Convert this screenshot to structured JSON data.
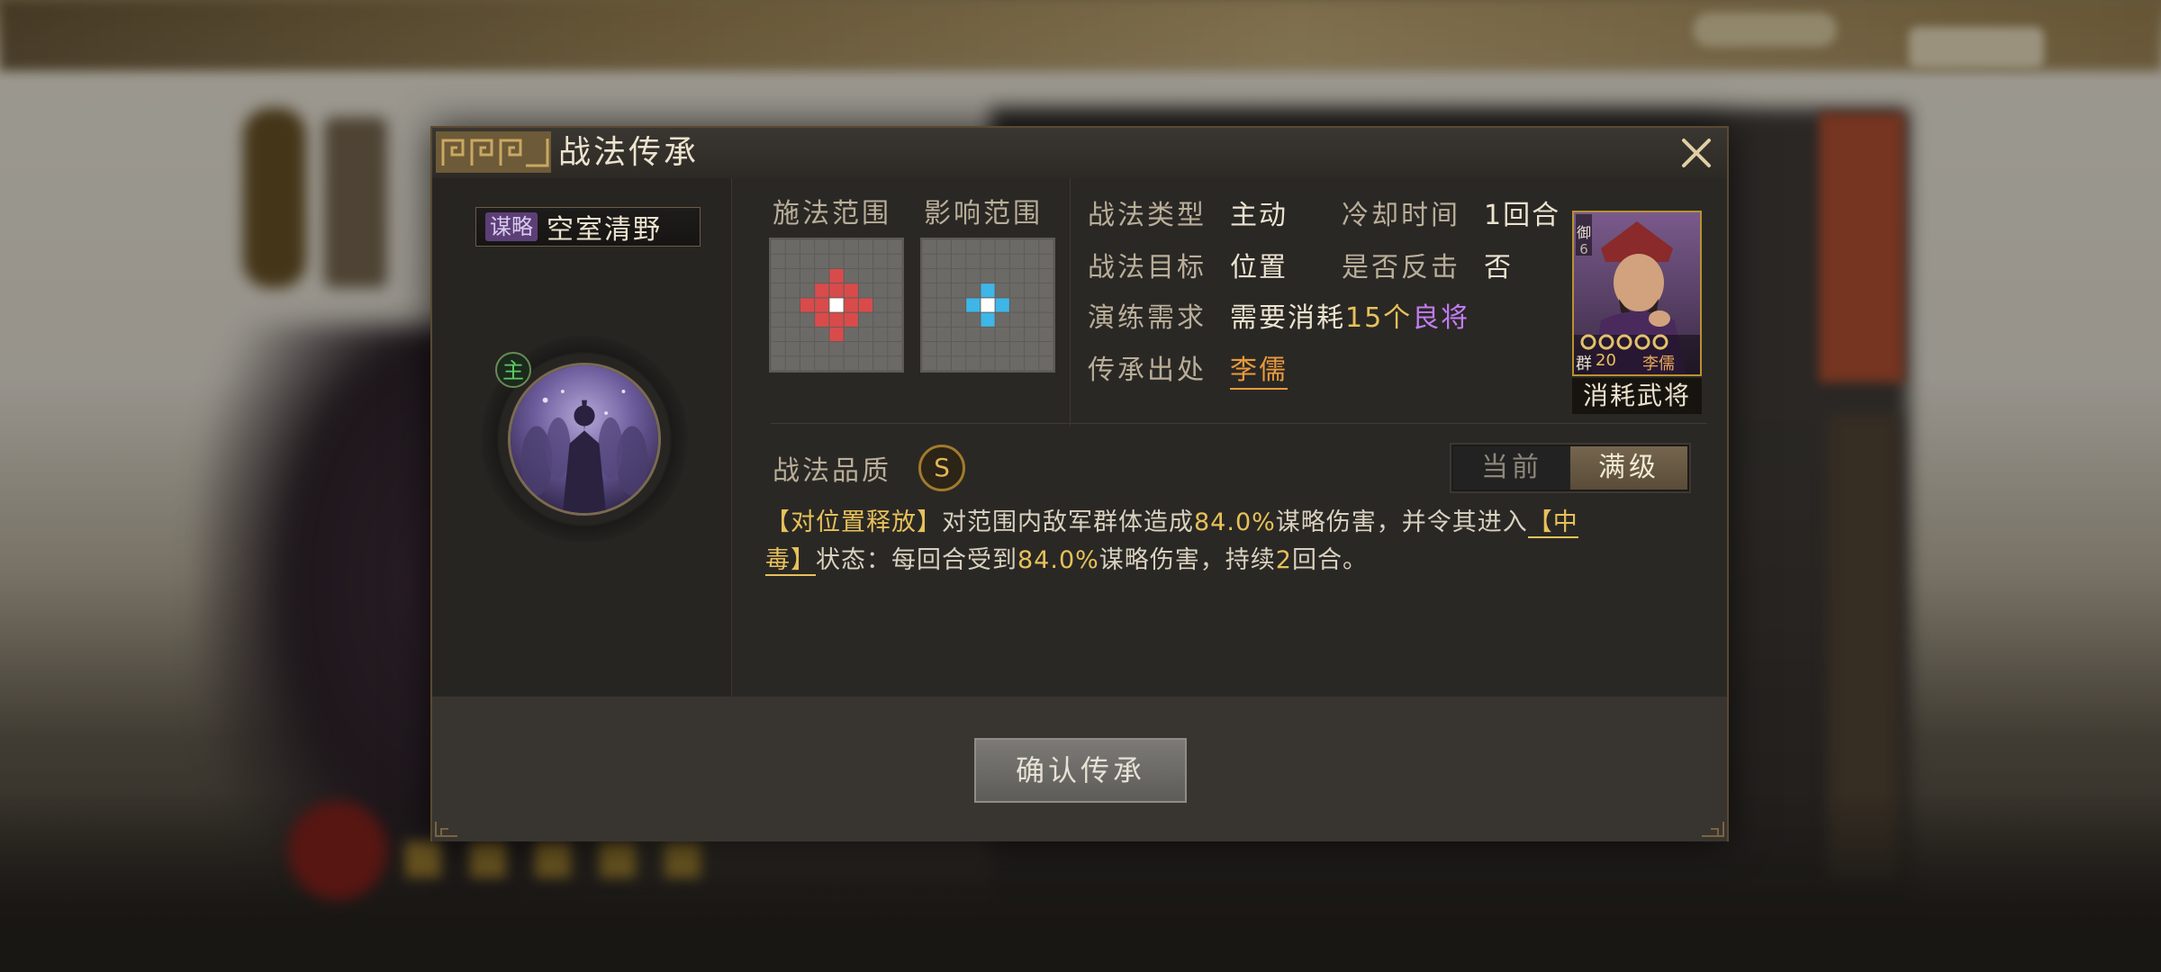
{
  "dialog": {
    "title": "战法传承",
    "skill_tag": "谋略",
    "skill_name": "空室清野",
    "main_badge": "主",
    "cast_range_label": "施法范围",
    "effect_range_label": "影响范围",
    "cast_pattern": [
      [
        0,
        0,
        0,
        0,
        0,
        0,
        0,
        0,
        0
      ],
      [
        0,
        0,
        0,
        0,
        0,
        0,
        0,
        0,
        0
      ],
      [
        0,
        0,
        0,
        0,
        1,
        0,
        0,
        0,
        0
      ],
      [
        0,
        0,
        0,
        1,
        1,
        1,
        0,
        0,
        0
      ],
      [
        0,
        0,
        1,
        1,
        2,
        1,
        1,
        0,
        0
      ],
      [
        0,
        0,
        0,
        1,
        1,
        1,
        0,
        0,
        0
      ],
      [
        0,
        0,
        0,
        0,
        1,
        0,
        0,
        0,
        0
      ],
      [
        0,
        0,
        0,
        0,
        0,
        0,
        0,
        0,
        0
      ],
      [
        0,
        0,
        0,
        0,
        0,
        0,
        0,
        0,
        0
      ]
    ],
    "effect_pattern": [
      [
        0,
        0,
        0,
        0,
        0,
        0,
        0,
        0,
        0
      ],
      [
        0,
        0,
        0,
        0,
        0,
        0,
        0,
        0,
        0
      ],
      [
        0,
        0,
        0,
        0,
        0,
        0,
        0,
        0,
        0
      ],
      [
        0,
        0,
        0,
        0,
        3,
        0,
        0,
        0,
        0
      ],
      [
        0,
        0,
        0,
        3,
        2,
        3,
        0,
        0,
        0
      ],
      [
        0,
        0,
        0,
        0,
        3,
        0,
        0,
        0,
        0
      ],
      [
        0,
        0,
        0,
        0,
        0,
        0,
        0,
        0,
        0
      ],
      [
        0,
        0,
        0,
        0,
        0,
        0,
        0,
        0,
        0
      ],
      [
        0,
        0,
        0,
        0,
        0,
        0,
        0,
        0,
        0
      ]
    ],
    "info": {
      "type_label": "战法类型",
      "type_value": "主动",
      "cooldown_label": "冷却时间",
      "cooldown_value": "1回合",
      "target_label": "战法目标",
      "target_value": "位置",
      "counter_label": "是否反击",
      "counter_value": "否",
      "practice_label": "演练需求",
      "practice_prefix": "需要消耗",
      "practice_count": "15个",
      "practice_item": "良将",
      "source_label": "传承出处",
      "source_value": "李儒"
    },
    "card": {
      "faction": "群",
      "level": "20",
      "name": "李儒",
      "cost_mark": "御",
      "cost": "6",
      "caption": "消耗武将"
    },
    "quality_label": "战法品质",
    "quality_value": "S",
    "toggle": {
      "current": "当前",
      "max": "满级"
    },
    "desc": {
      "tag": "【对位置释放】",
      "p1": "对范围内敌军群体造成",
      "v1": "84.0%",
      "p2": "谋略伤害，并令其进入",
      "status1": "【中",
      "status2": "毒】",
      "p3": "状态：每回合受到",
      "v2": "84.0%",
      "p4": "谋略伤害，持续",
      "v3": "2",
      "p5": "回合。"
    },
    "confirm": "确认传承"
  },
  "colors": {
    "accent_gold": "#e7c15a",
    "link_orange": "#e99a3c",
    "purple_item": "#c27cf2",
    "cast_red": "#d94b4b",
    "effect_blue": "#3fb6e8"
  }
}
